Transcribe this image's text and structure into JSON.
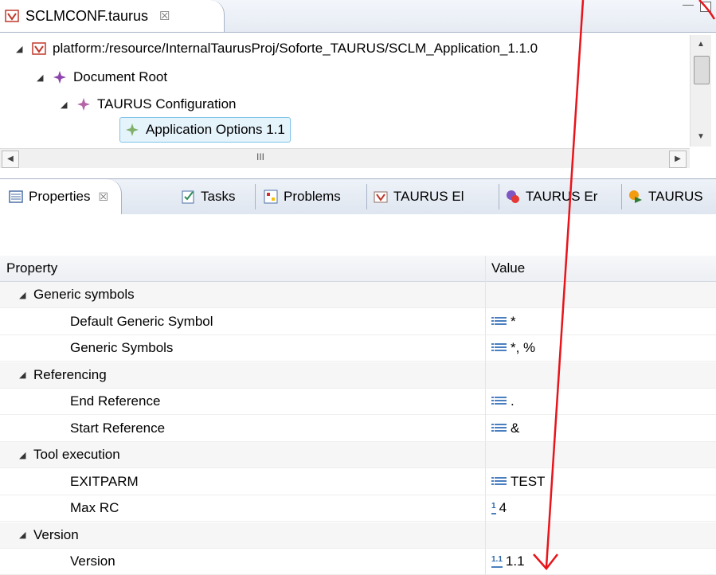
{
  "editor": {
    "tab_label": "SCLMCONF.taurus",
    "tab_close": "☒",
    "tree": [
      {
        "label": "platform:/resource/InternalTaurusProj/Soforte_TAURUS/SCLM_Application_1.1.0",
        "expanded": true
      },
      {
        "label": "Document Root",
        "expanded": true
      },
      {
        "label": "TAURUS Configuration",
        "expanded": true
      },
      {
        "label": "Application Options 1.1",
        "selected": true
      }
    ],
    "hscroll_grip": "III"
  },
  "views": {
    "tabs": [
      {
        "label": "Properties",
        "close": "☒",
        "active": true
      },
      {
        "label": "Tasks"
      },
      {
        "label": "Problems"
      },
      {
        "label": "TAURUS El"
      },
      {
        "label": "TAURUS Er"
      },
      {
        "label": "TAURUS"
      }
    ]
  },
  "properties": {
    "header": {
      "property": "Property",
      "value": "Value"
    },
    "rows": [
      {
        "kind": "category",
        "property": "Generic symbols",
        "value": ""
      },
      {
        "kind": "item",
        "property": "Default Generic Symbol",
        "value": "*",
        "icon": "text-list-icon"
      },
      {
        "kind": "item",
        "property": "Generic Symbols",
        "value": "*, %",
        "icon": "text-list-icon"
      },
      {
        "kind": "category",
        "property": "Referencing",
        "value": ""
      },
      {
        "kind": "item",
        "property": "End Reference",
        "value": ".",
        "icon": "text-list-icon"
      },
      {
        "kind": "item",
        "property": "Start Reference",
        "value": "&",
        "icon": "text-list-icon"
      },
      {
        "kind": "category",
        "property": "Tool execution",
        "value": ""
      },
      {
        "kind": "item",
        "property": "EXITPARM",
        "value": "TEST",
        "icon": "text-list-icon"
      },
      {
        "kind": "item",
        "property": "Max RC",
        "value": "4",
        "icon": "integer-icon",
        "icon_text": "1"
      },
      {
        "kind": "category",
        "property": "Version",
        "value": ""
      },
      {
        "kind": "item",
        "property": "Version",
        "value": "1.1",
        "icon": "decimal-icon",
        "icon_text": "1.1"
      }
    ]
  },
  "annotation": {
    "color": "#e8141b"
  }
}
